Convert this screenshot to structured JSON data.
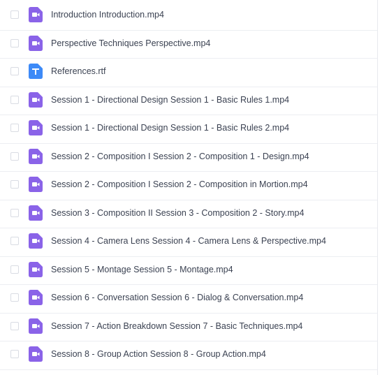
{
  "colors": {
    "video_icon": "#8a63e8",
    "text_icon": "#3d8af7",
    "row_divider": "#eceef2"
  },
  "files": [
    {
      "name": "Introduction Introduction.mp4",
      "icon": "video-file-icon"
    },
    {
      "name": "Perspective Techniques Perspective.mp4",
      "icon": "video-file-icon"
    },
    {
      "name": "References.rtf",
      "icon": "text-file-icon"
    },
    {
      "name": "Session 1 - Directional Design Session 1 - Basic Rules 1.mp4",
      "icon": "video-file-icon"
    },
    {
      "name": "Session 1 - Directional Design Session 1 - Basic Rules 2.mp4",
      "icon": "video-file-icon"
    },
    {
      "name": "Session 2 - Composition I Session 2 - Composition 1 - Design.mp4",
      "icon": "video-file-icon"
    },
    {
      "name": "Session 2 - Composition I Session 2 - Composition in Mortion.mp4",
      "icon": "video-file-icon"
    },
    {
      "name": "Session 3 - Composition II Session 3 - Composition 2 - Story.mp4",
      "icon": "video-file-icon"
    },
    {
      "name": "Session 4 - Camera Lens Session 4 - Camera Lens & Perspective.mp4",
      "icon": "video-file-icon"
    },
    {
      "name": "Session 5 - Montage Session 5 - Montage.mp4",
      "icon": "video-file-icon"
    },
    {
      "name": "Session 6 - Conversation Session 6 - Dialog & Conversation.mp4",
      "icon": "video-file-icon"
    },
    {
      "name": "Session 7 - Action Breakdown Session 7 - Basic Techniques.mp4",
      "icon": "video-file-icon"
    },
    {
      "name": "Session 8 - Group Action Session 8 - Group Action.mp4",
      "icon": "video-file-icon"
    }
  ]
}
